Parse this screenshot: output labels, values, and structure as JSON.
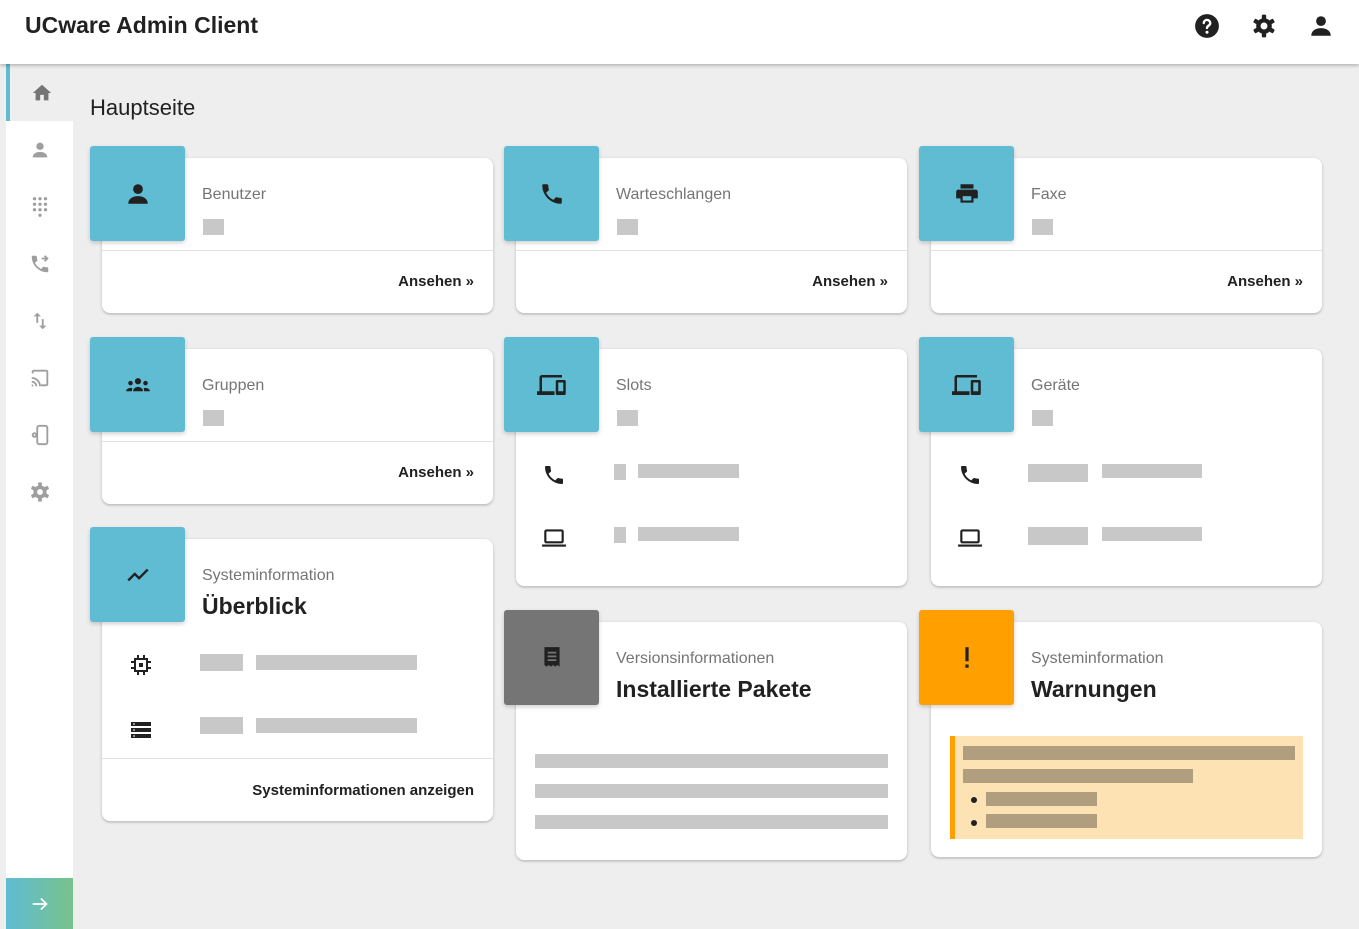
{
  "app": {
    "title": "UCware Admin Client"
  },
  "topbar": {
    "icons": [
      "help-icon",
      "settings-icon",
      "account-icon"
    ]
  },
  "sidebar": {
    "items": [
      {
        "icon": "home-icon",
        "active": true
      },
      {
        "icon": "person-icon"
      },
      {
        "icon": "dialpad-icon"
      },
      {
        "icon": "phone-forward-icon"
      },
      {
        "icon": "swap-vert-icon"
      },
      {
        "icon": "cast-icon"
      },
      {
        "icon": "phonelink-setup-icon"
      },
      {
        "icon": "settings-icon"
      }
    ],
    "expand_icon": "arrow-right-icon"
  },
  "page": {
    "title": "Hauptseite"
  },
  "cards": {
    "benutzer": {
      "label": "Benutzer",
      "link": "Ansehen »",
      "icon": "person-icon"
    },
    "warteschlangen": {
      "label": "Warteschlangen",
      "link": "Ansehen »",
      "icon": "phone-icon"
    },
    "faxe": {
      "label": "Faxe",
      "link": "Ansehen »",
      "icon": "printer-icon"
    },
    "gruppen": {
      "label": "Gruppen",
      "link": "Ansehen »",
      "icon": "groups-icon"
    },
    "slots": {
      "label": "Slots",
      "icon": "devices-icon"
    },
    "geraete": {
      "label": "Geräte",
      "icon": "devices-icon"
    },
    "overview": {
      "subtitle": "Systeminformation",
      "title": "Überblick",
      "link": "Systeminformationen anzeigen",
      "icon": "trending-icon"
    },
    "packages": {
      "subtitle": "Versionsinformationen",
      "title": "Installierte Pakete",
      "icon": "receipt-icon"
    },
    "warnings": {
      "subtitle": "Systeminformation",
      "title": "Warnungen",
      "icon": "exclamation-icon"
    }
  },
  "colors": {
    "accent": "#5fbcd3",
    "warning": "#ffa000",
    "neutral": "#757575",
    "background": "#eeeeee"
  }
}
